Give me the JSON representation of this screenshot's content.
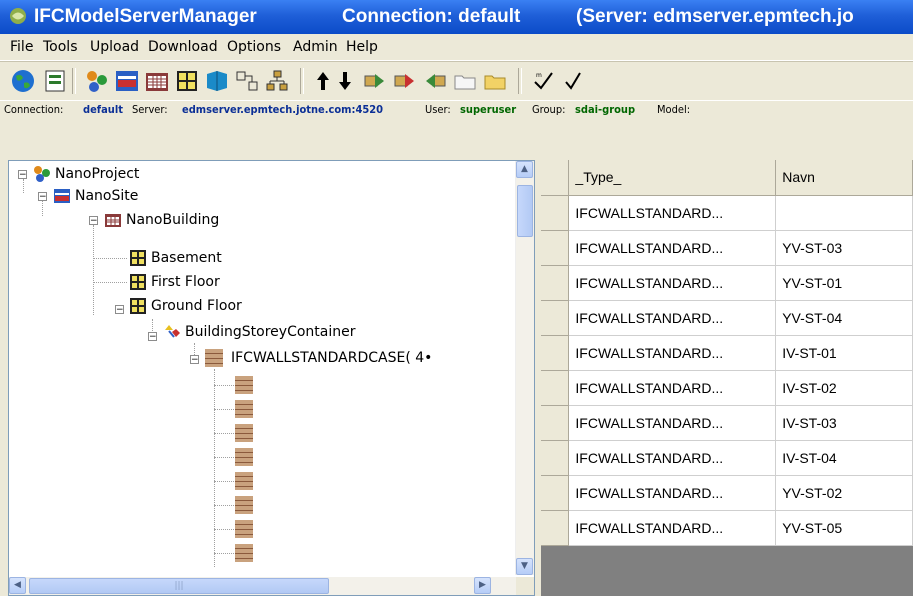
{
  "window": {
    "app_name": "IFCModelServerManager",
    "connection": "Connection: default",
    "server": "(Server: edmserver.epmtech.jo"
  },
  "menu": [
    "File",
    "Tools",
    "Upload",
    "Download",
    "Options",
    "Admin",
    "Help"
  ],
  "toolbar_icons": [
    "globe-icon",
    "open-model-icon",
    "project-icon",
    "site-icon",
    "building-icon",
    "storey-icon",
    "element-icon",
    "relation-icon",
    "hierarchy-icon",
    "arrow-up-icon",
    "arrow-down-icon",
    "forward-icon",
    "forward-add-icon",
    "back-icon",
    "folder-empty-icon",
    "folder-icon",
    "check-icon",
    "check-small-icon"
  ],
  "connection_bar": {
    "connection_label": "Connection:",
    "connection_value": "default",
    "server_label": "Server:",
    "server_value": "edmserver.epmtech.jotne.com:4520",
    "user_label": "User:",
    "user_value": "superuser",
    "group_label": "Group:",
    "group_value": "sdai-group",
    "model_label": "Model:"
  },
  "tree": {
    "project": "NanoProject",
    "site": "NanoSite",
    "building": "NanoBuilding",
    "storeys": [
      "Basement",
      "First Floor",
      "Ground Floor"
    ],
    "container": "BuildingStoreyContainer",
    "wall_group": "IFCWALLSTANDARDCASE( 4•"
  },
  "grid": {
    "columns": [
      "_Type_",
      "Navn"
    ],
    "rows": [
      [
        "IFCWALLSTANDARD...",
        ""
      ],
      [
        "IFCWALLSTANDARD...",
        "YV-ST-03"
      ],
      [
        "IFCWALLSTANDARD...",
        "YV-ST-01"
      ],
      [
        "IFCWALLSTANDARD...",
        "YV-ST-04"
      ],
      [
        "IFCWALLSTANDARD...",
        "IV-ST-01"
      ],
      [
        "IFCWALLSTANDARD...",
        "IV-ST-02"
      ],
      [
        "IFCWALLSTANDARD...",
        "IV-ST-03"
      ],
      [
        "IFCWALLSTANDARD...",
        "IV-ST-04"
      ],
      [
        "IFCWALLSTANDARD...",
        "YV-ST-02"
      ],
      [
        "IFCWALLSTANDARD...",
        "YV-ST-05"
      ]
    ]
  },
  "colors": {
    "titlebar": "#1f5fd8",
    "connection_value": "#0b2f96",
    "user_value": "#006600"
  }
}
